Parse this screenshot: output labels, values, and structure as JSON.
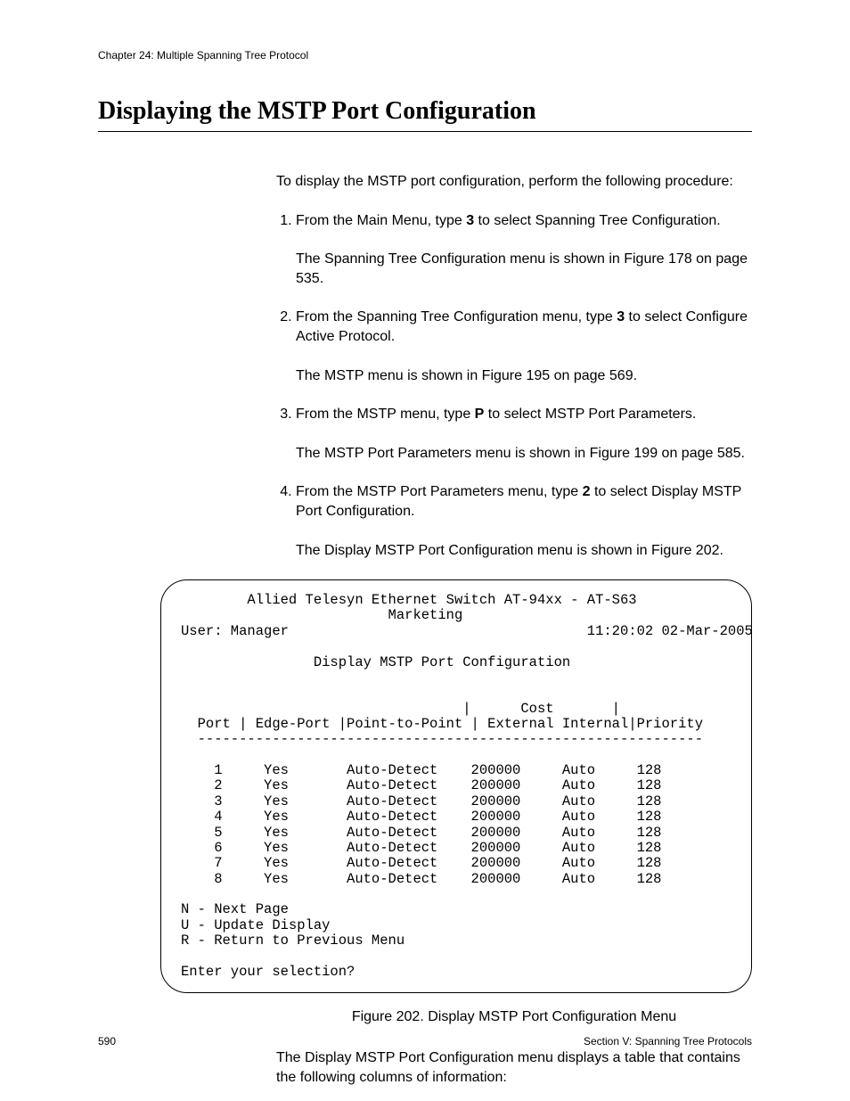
{
  "header": {
    "chapter": "Chapter 24: Multiple Spanning Tree Protocol"
  },
  "title": "Displaying the MSTP Port Configuration",
  "intro": "To display the MSTP port configuration, perform the following procedure:",
  "steps": {
    "s1_a": "From the Main Menu, type ",
    "s1_b": "3",
    "s1_c": " to select Spanning Tree Configuration.",
    "s1_sub": "The Spanning Tree Configuration menu is shown in Figure 178 on page 535.",
    "s2_a": "From the Spanning Tree Configuration menu, type ",
    "s2_b": "3",
    "s2_c": " to select Configure Active Protocol.",
    "s2_sub": "The MSTP menu is shown in Figure 195 on page 569.",
    "s3_a": "From the MSTP menu, type ",
    "s3_b": "P",
    "s3_c": " to select MSTP Port Parameters.",
    "s3_sub": "The MSTP Port Parameters menu is shown in Figure 199 on page 585.",
    "s4_a": "From the MSTP Port Parameters menu, type ",
    "s4_b": "2",
    "s4_c": " to select Display MSTP Port Configuration.",
    "s4_sub": "The Display MSTP Port Configuration menu is shown in Figure 202."
  },
  "terminal": {
    "line1": "Allied Telesyn Ethernet Switch AT-94xx - AT-S63",
    "line2": "Marketing",
    "user_label": "User: Manager",
    "timestamp": "11:20:02 02-Mar-2005",
    "screen_title": "Display MSTP Port Configuration",
    "col_header1": "                                  |      Cost       |",
    "col_header2": "  Port | Edge-Port |Point-to-Point | External Internal|Priority",
    "col_rule": "  -------------------------------------------------------------",
    "rows": [
      "    1     Yes       Auto-Detect    200000     Auto     128",
      "    2     Yes       Auto-Detect    200000     Auto     128",
      "    3     Yes       Auto-Detect    200000     Auto     128",
      "    4     Yes       Auto-Detect    200000     Auto     128",
      "    5     Yes       Auto-Detect    200000     Auto     128",
      "    6     Yes       Auto-Detect    200000     Auto     128",
      "    7     Yes       Auto-Detect    200000     Auto     128",
      "    8     Yes       Auto-Detect    200000     Auto     128"
    ],
    "opt_n": "N - Next Page",
    "opt_u": "U - Update Display",
    "opt_r": "R - Return to Previous Menu",
    "prompt": "Enter your selection?"
  },
  "figure_caption": "Figure 202. Display MSTP Port Configuration Menu",
  "after_fig": "The Display MSTP Port Configuration menu displays a table that contains the following columns of information:",
  "footer": {
    "page": "590",
    "section": "Section V: Spanning Tree Protocols"
  }
}
